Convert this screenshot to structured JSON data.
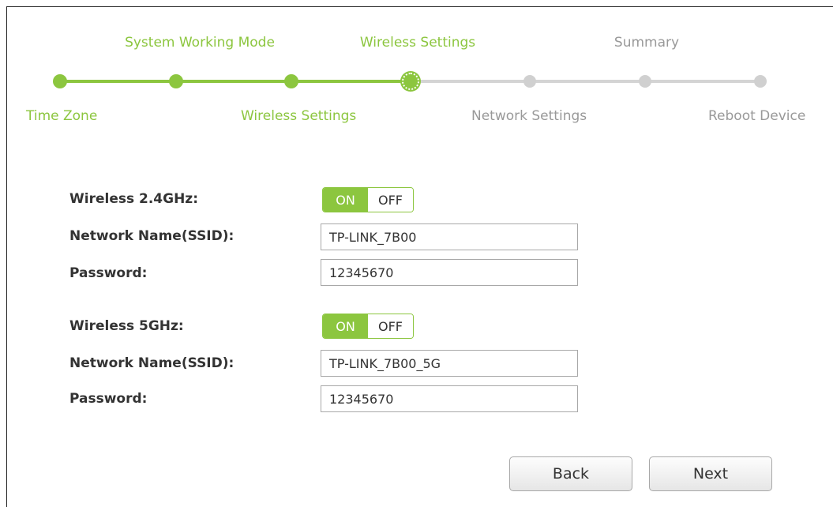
{
  "steps": {
    "top": [
      "System Working Mode",
      "Wireless Settings",
      "Summary"
    ],
    "bottom": [
      "Time Zone",
      "Wireless Settings",
      "Network Settings",
      "Reboot Device"
    ]
  },
  "colors": {
    "accent": "#8cc63f",
    "inactive": "#999999",
    "track_inactive": "#d4d4d4"
  },
  "band24": {
    "label": "Wireless 2.4GHz:",
    "toggle_on": "ON",
    "toggle_off": "OFF",
    "ssid_label": "Network Name(SSID):",
    "ssid_value": "TP-LINK_7B00",
    "password_label": "Password:",
    "password_value": "12345670"
  },
  "band5": {
    "label": "Wireless 5GHz:",
    "toggle_on": "ON",
    "toggle_off": "OFF",
    "ssid_label": "Network Name(SSID):",
    "ssid_value": "TP-LINK_7B00_5G",
    "password_label": "Password:",
    "password_value": "12345670"
  },
  "buttons": {
    "back": "Back",
    "next": "Next"
  }
}
